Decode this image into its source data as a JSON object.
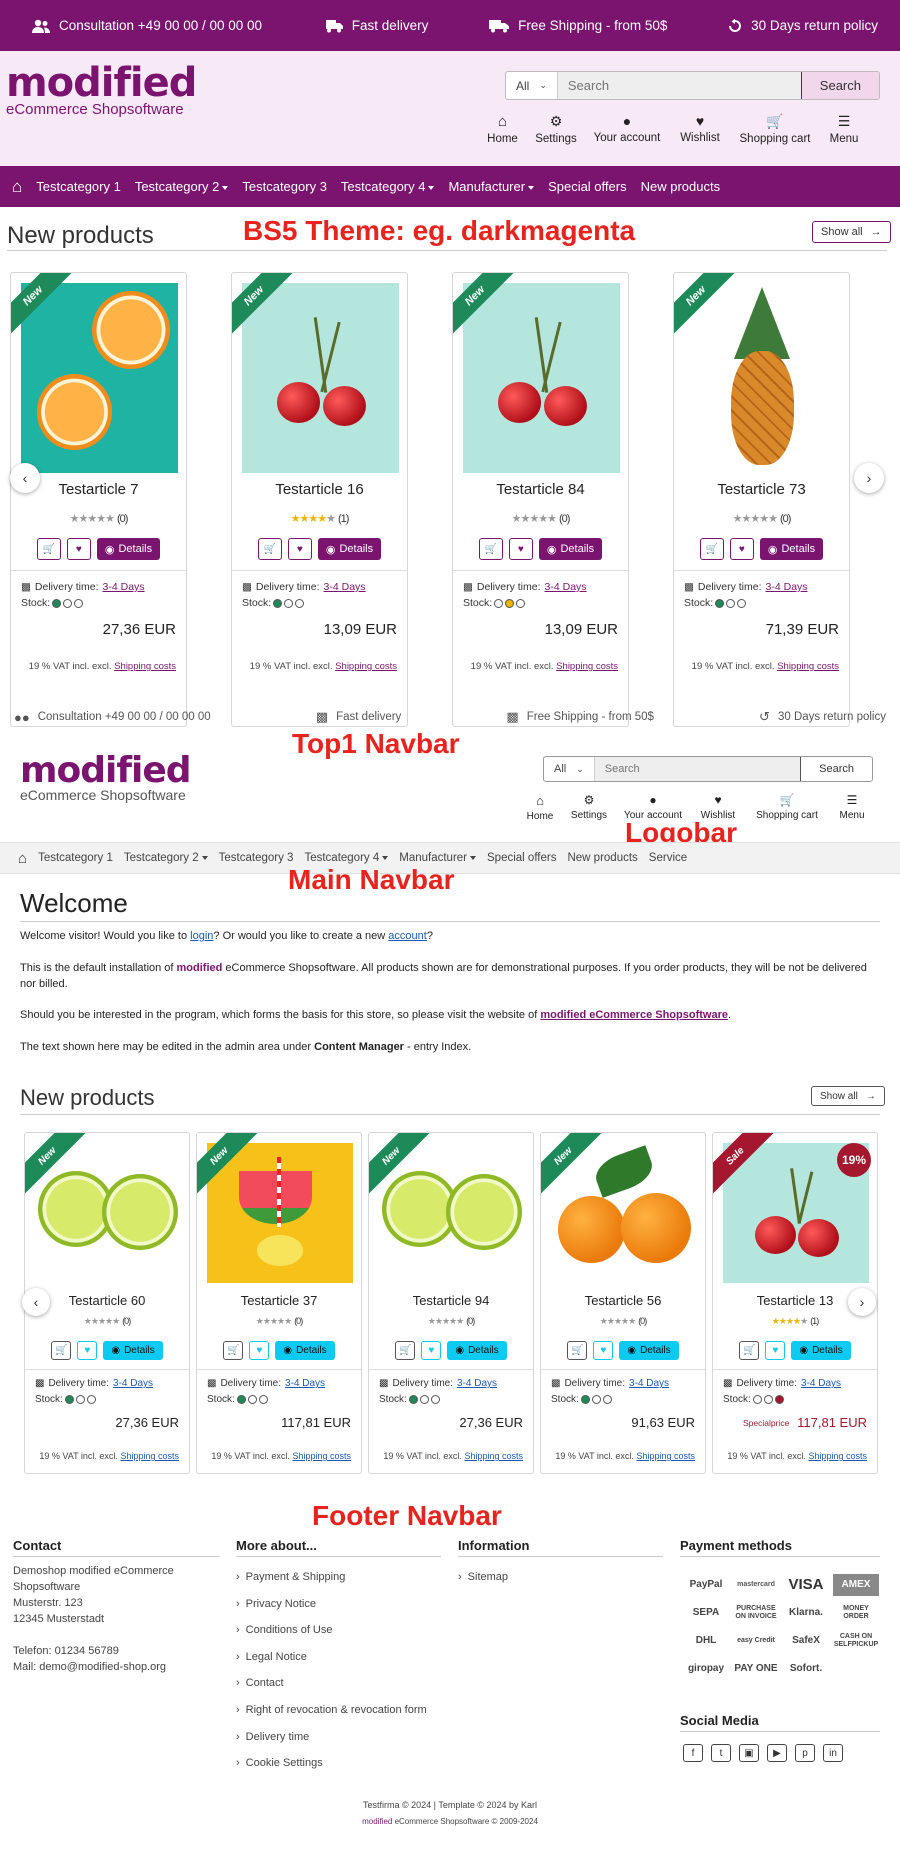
{
  "top_bar": {
    "consultation": "Consultation +49 00 00 / 00 00 00",
    "fast_delivery": "Fast delivery",
    "free_shipping": "Free Shipping - from 50$",
    "returns": "30 Days return policy"
  },
  "logo": {
    "word": "modified",
    "sub": "eCommerce Shopsoftware"
  },
  "search": {
    "category": "All",
    "placeholder": "Search",
    "button": "Search"
  },
  "icon_nav": [
    "Home",
    "Settings",
    "Your account",
    "Wishlist",
    "Shopping cart",
    "Menu"
  ],
  "main_nav": {
    "items": [
      "Testcategory 1",
      "Testcategory 2",
      "Testcategory 3",
      "Testcategory 4",
      "Manufacturer",
      "Special offers",
      "New products"
    ],
    "items2": [
      "Testcategory 1",
      "Testcategory 2",
      "Testcategory 3",
      "Testcategory 4",
      "Manufacturer",
      "Special offers",
      "New products",
      "Service"
    ]
  },
  "annotations": {
    "theme": "BS5 Theme: eg. darkmagenta",
    "top1": "Top1 Navbar",
    "logobar": "Logobar",
    "mainnav": "Main Navbar",
    "footer": "Footer Navbar"
  },
  "section1": {
    "title": "New products",
    "show_all": "Show all",
    "products": [
      {
        "name": "Testarticle 7",
        "rating_text": "(0)",
        "delivery_label": "Delivery time:",
        "delivery": "3-4 Days",
        "stock_label": "Stock:",
        "price": "27,36 EUR",
        "vat": "19 % VAT incl. excl.",
        "shipping": "Shipping costs",
        "ribbon": "New"
      },
      {
        "name": "Testarticle 16",
        "rating_text": "(1)",
        "delivery_label": "Delivery time:",
        "delivery": "3-4 Days",
        "stock_label": "Stock:",
        "price": "13,09 EUR",
        "vat": "19 % VAT incl. excl.",
        "shipping": "Shipping costs",
        "ribbon": "New"
      },
      {
        "name": "Testarticle 84",
        "rating_text": "(0)",
        "delivery_label": "Delivery time:",
        "delivery": "3-4 Days",
        "stock_label": "Stock:",
        "price": "13,09 EUR",
        "vat": "19 % VAT incl. excl.",
        "shipping": "Shipping costs",
        "ribbon": "New"
      },
      {
        "name": "Testarticle 73",
        "rating_text": "(0)",
        "delivery_label": "Delivery time:",
        "delivery": "3-4 Days",
        "stock_label": "Stock:",
        "price": "71,39 EUR",
        "vat": "19 % VAT incl. excl.",
        "shipping": "Shipping costs",
        "ribbon": "New"
      }
    ],
    "details": "Details"
  },
  "welcome": {
    "title": "Welcome",
    "p1_a": "Welcome visitor! Would you like to ",
    "p1_login": "login",
    "p1_b": "? Or would you like to create a new ",
    "p1_account": "account",
    "p1_c": "?",
    "p2_a": "This is the default installation of ",
    "p2_mod": "modified",
    "p2_b": " eCommerce Shopsoftware. All products shown are for demonstrational purposes. If you order products, they will be not be delivered nor billed.",
    "p3_a": "Should you be interested in the program, which forms the basis for this store, so please visit the website of ",
    "p3_link": "modified eCommerce Shopsoftware",
    "p3_b": ".",
    "p4_a": "The text shown here may be edited in the admin area under ",
    "p4_b": "Content Manager",
    "p4_c": " - entry Index."
  },
  "section2": {
    "title": "New products",
    "show_all": "Show all",
    "products": [
      {
        "name": "Testarticle 60",
        "rating_text": "(0)",
        "delivery": "3-4 Days",
        "price": "27,36 EUR",
        "ribbon": "New"
      },
      {
        "name": "Testarticle 37",
        "rating_text": "(0)",
        "delivery": "3-4 Days",
        "price": "117,81 EUR",
        "ribbon": "New"
      },
      {
        "name": "Testarticle 94",
        "rating_text": "(0)",
        "delivery": "3-4 Days",
        "price": "27,36 EUR",
        "ribbon": "New"
      },
      {
        "name": "Testarticle 56",
        "rating_text": "(0)",
        "delivery": "3-4 Days",
        "price": "91,63 EUR",
        "ribbon": "New"
      },
      {
        "name": "Testarticle 13",
        "rating_text": "(1)",
        "delivery": "3-4 Days",
        "price": "117,81 EUR",
        "special_label": "Specialprice",
        "ribbon": "Sale",
        "discount": "19%"
      }
    ],
    "delivery_label": "Delivery time:",
    "stock_label": "Stock:",
    "vat": "19 % VAT incl. excl.",
    "shipping": "Shipping costs",
    "details": "Details"
  },
  "footer": {
    "contact": {
      "title": "Contact",
      "lines": [
        "Demoshop modified eCommerce",
        "Shopsoftware",
        "Musterstr. 123",
        "12345 Musterstadt",
        "",
        "Telefon: 01234 56789",
        "Mail: demo@modified-shop.org"
      ]
    },
    "more": {
      "title": "More about...",
      "items": [
        "Payment & Shipping",
        "Privacy Notice",
        "Conditions of Use",
        "Legal Notice",
        "Contact",
        "Right of revocation & revocation form",
        "Delivery time",
        "Cookie Settings"
      ]
    },
    "info": {
      "title": "Information",
      "items": [
        "Sitemap"
      ]
    },
    "payment": {
      "title": "Payment methods",
      "logos": [
        "PayPal",
        "mastercard",
        "VISA",
        "AMEX",
        "SEPA",
        "PURCHASE ON INVOICE",
        "Klarna.",
        "MONEY ORDER",
        "DHL",
        "easy Credit",
        "SafeX",
        "CASH ON SELFPICKUP",
        "giropay",
        "PAY ONE",
        "Sofort."
      ]
    },
    "social": {
      "title": "Social Media"
    },
    "copyright1": "Testfirma © 2024 | Template © 2024 by Karl",
    "copyright2_mod": "modified",
    "copyright2": " eCommerce Shopsoftware © 2009-2024"
  },
  "colors": {
    "brand": "#7a146f",
    "new_ribbon": "#1e8a5a",
    "sale_ribbon": "#a5172e",
    "cyan": "#0dcaf0"
  }
}
